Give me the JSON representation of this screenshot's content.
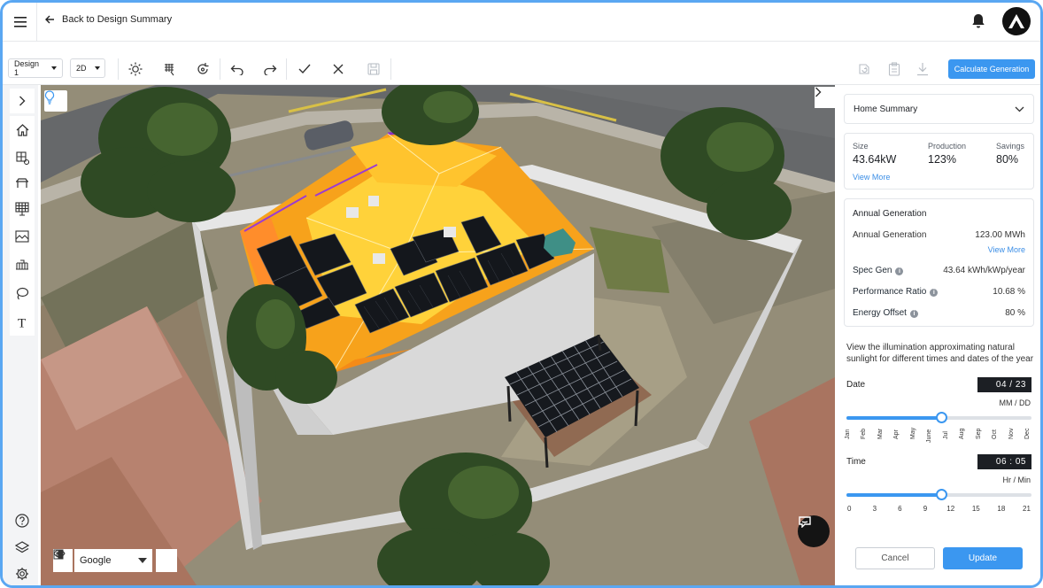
{
  "header": {
    "back_label": "Back to Design Summary"
  },
  "toolbar": {
    "design_select": "Design 1",
    "view_select": "2D",
    "calculate_label": "Calculate Generation"
  },
  "map": {
    "imagery_source": "Google"
  },
  "panel": {
    "summary_dropdown": "Home Summary",
    "stats": [
      {
        "label": "Size",
        "value": "43.64kW"
      },
      {
        "label": "Production",
        "value": "123%"
      },
      {
        "label": "Savings",
        "value": "80%"
      }
    ],
    "view_more": "View More",
    "annual": {
      "heading": "Annual Generation",
      "gen_label": "Annual Generation",
      "gen_value": "123.00 MWh",
      "view_more": "View More",
      "rows": [
        {
          "label": "Spec Gen",
          "value": "43.64 kWh/kWp/year"
        },
        {
          "label": "Performance Ratio",
          "value": "10.68 %"
        },
        {
          "label": "Energy Offset",
          "value": "80 %"
        }
      ]
    },
    "illumination_text": "View the illumination approximating natural sunlight for different times and dates of the year",
    "date": {
      "label": "Date",
      "value": "04 / 23",
      "format": "MM / DD",
      "position": 0.51,
      "months": [
        "Jan",
        "Feb",
        "Mar",
        "Apr",
        "May",
        "June",
        "Jul",
        "Aug",
        "Sep",
        "Oct",
        "Nov",
        "Dec"
      ]
    },
    "time": {
      "label": "Time",
      "value": "06 : 05",
      "format": "Hr / Min",
      "position": 0.51,
      "hours": [
        "0",
        "3",
        "6",
        "9",
        "12",
        "15",
        "18",
        "21"
      ]
    },
    "cancel_label": "Cancel",
    "update_label": "Update"
  },
  "colors": {
    "accent": "#3b97f0",
    "frame": "#5aa7f2",
    "heatmap_hot": "#f7a21b",
    "heatmap_warm": "#ffe14a",
    "panel_dark": "#1c1f24"
  }
}
